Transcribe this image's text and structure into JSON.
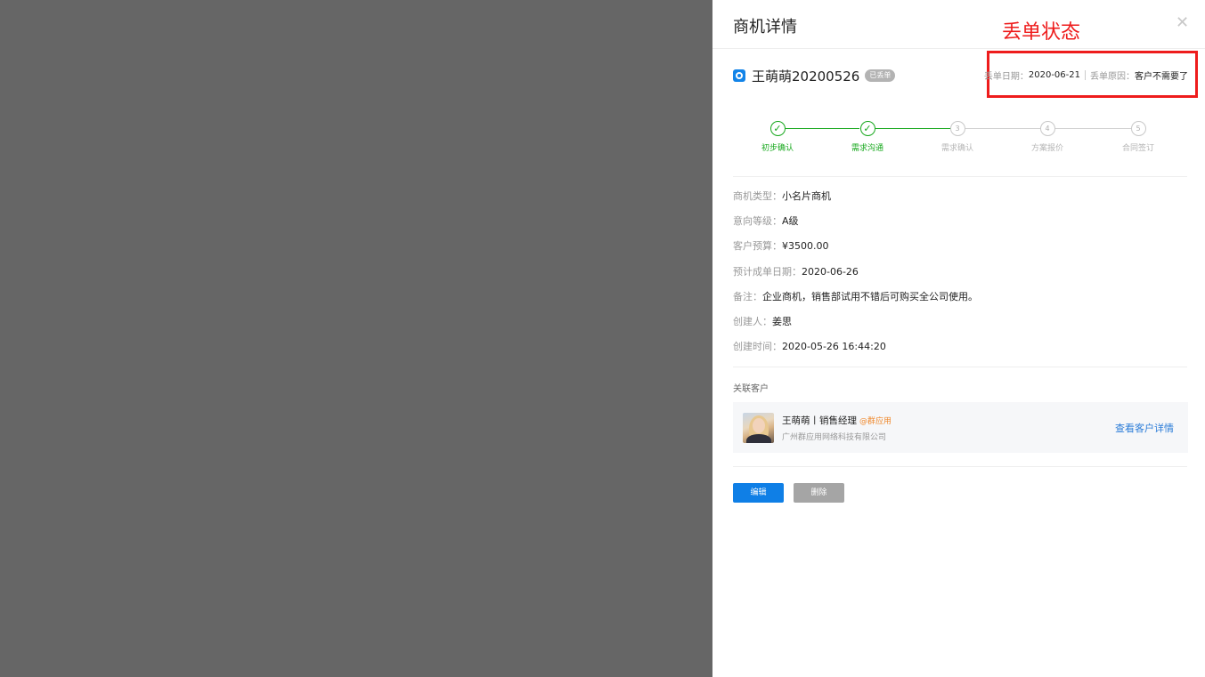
{
  "drawer": {
    "title": "商机详情",
    "close_icon": "close-icon"
  },
  "annotation": {
    "label": "丢单状态",
    "color": "#ee1c1c"
  },
  "opportunity": {
    "name": "王萌萌20200526",
    "status_badge": "已丢单",
    "icon": "opportunity-icon"
  },
  "lost_info": {
    "date_label": "丢单日期：",
    "date_value": "2020-06-21",
    "reason_label": "丢单原因：",
    "reason_value": "客户不需要了"
  },
  "steps": [
    {
      "label": "初步确认",
      "mark": "✓",
      "state": "done"
    },
    {
      "label": "需求沟通",
      "mark": "✓",
      "state": "done"
    },
    {
      "label": "需求确认",
      "mark": "3",
      "state": "pending"
    },
    {
      "label": "方案报价",
      "mark": "4",
      "state": "pending"
    },
    {
      "label": "合同签订",
      "mark": "5",
      "state": "pending"
    }
  ],
  "details": [
    {
      "label": "商机类型：",
      "value": "小名片商机"
    },
    {
      "label": "意向等级：",
      "value": "A级"
    },
    {
      "label": "客户预算：",
      "value": "¥3500.00"
    },
    {
      "label": "预计成单日期：",
      "value": "2020-06-26"
    },
    {
      "label": "备注：",
      "value": "企业商机，销售部试用不错后可购买全公司使用。"
    },
    {
      "label": "创建人：",
      "value": "姜思"
    },
    {
      "label": "创建时间：",
      "value": "2020-05-26 16:44:20"
    }
  ],
  "customer_section": {
    "title": "关联客户",
    "name": "王萌萌丨销售经理",
    "org_tag": "@群应用",
    "company": "广州群应用网络科技有限公司",
    "view_link": "查看客户详情"
  },
  "actions": {
    "edit": "编辑",
    "delete": "删除"
  },
  "colors": {
    "primary": "#0f7fe6",
    "success": "#17a81d",
    "overlay": "#666666"
  }
}
